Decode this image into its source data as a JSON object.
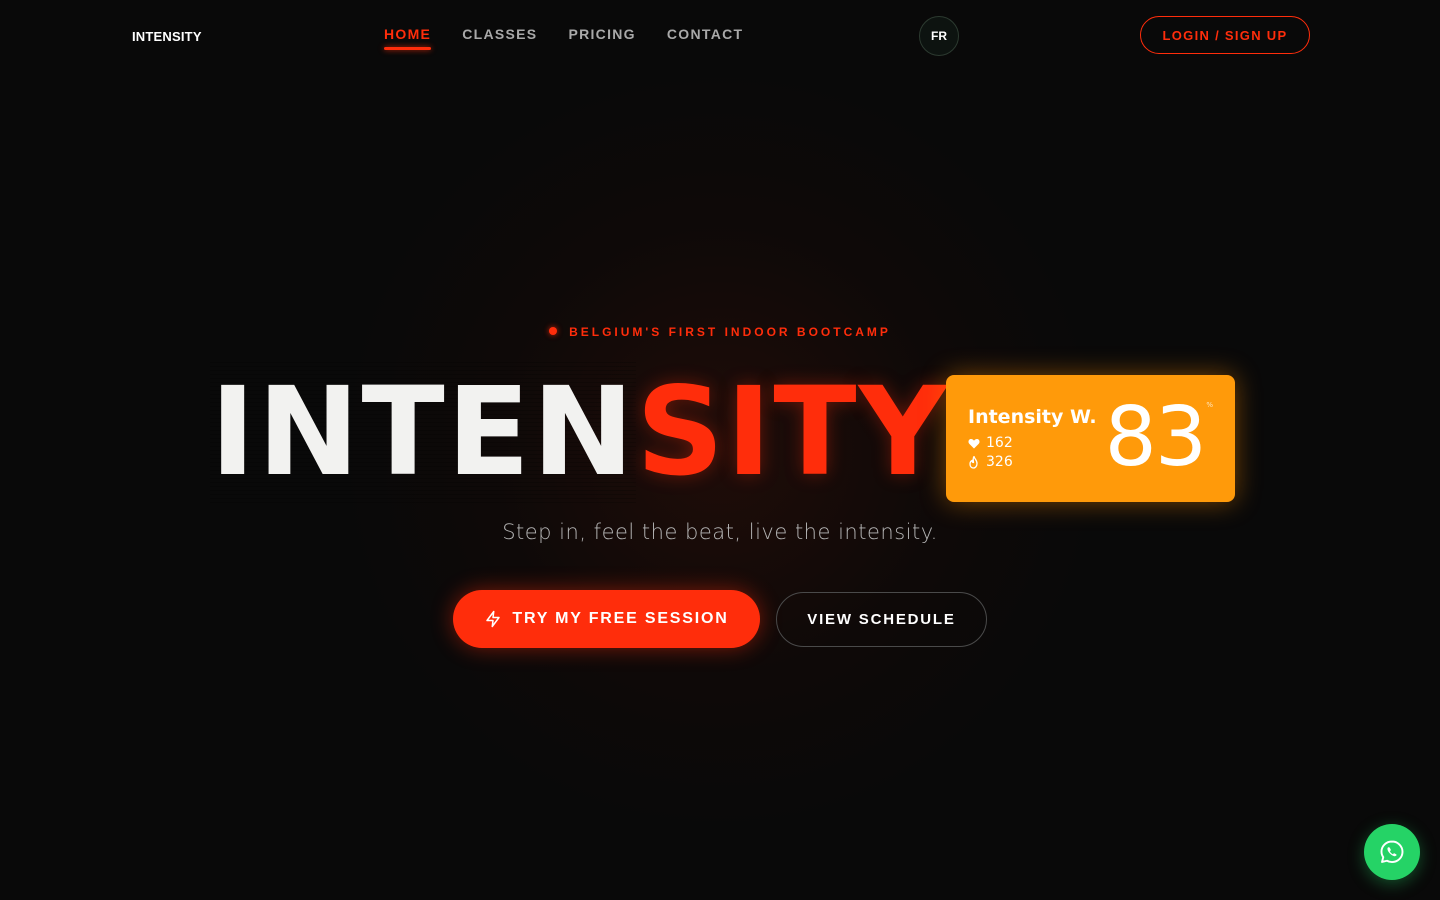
{
  "nav": {
    "logo": "INTENSITY",
    "items": [
      {
        "label": "HOME",
        "active": true
      },
      {
        "label": "CLASSES",
        "active": false
      },
      {
        "label": "PRICING",
        "active": false
      },
      {
        "label": "CONTACT",
        "active": false
      }
    ],
    "language": "FR",
    "login_label": "LOGIN / SIGN UP"
  },
  "hero": {
    "eyebrow": "BELGIUM'S FIRST INDOOR BOOTCAMP",
    "title_part_white": "INTEN",
    "title_part_red": "SITY",
    "tagline": "Step in, feel the beat, live the intensity.",
    "primary_cta": "TRY MY FREE SESSION",
    "secondary_cta": "VIEW SCHEDULE"
  },
  "stat_card": {
    "name": "Intensity W.",
    "heart_rate": "162",
    "calories": "326",
    "score": "83",
    "unit": "%"
  },
  "colors": {
    "accent": "#ff2d0b",
    "card": "#ff9a0a",
    "whatsapp": "#25d366",
    "background": "#090909"
  },
  "icons": {
    "primary_cta_icon": "lightning-icon",
    "heart_rate_icon": "heart-icon",
    "calories_icon": "flame-icon",
    "fab_icon": "whatsapp-icon"
  }
}
